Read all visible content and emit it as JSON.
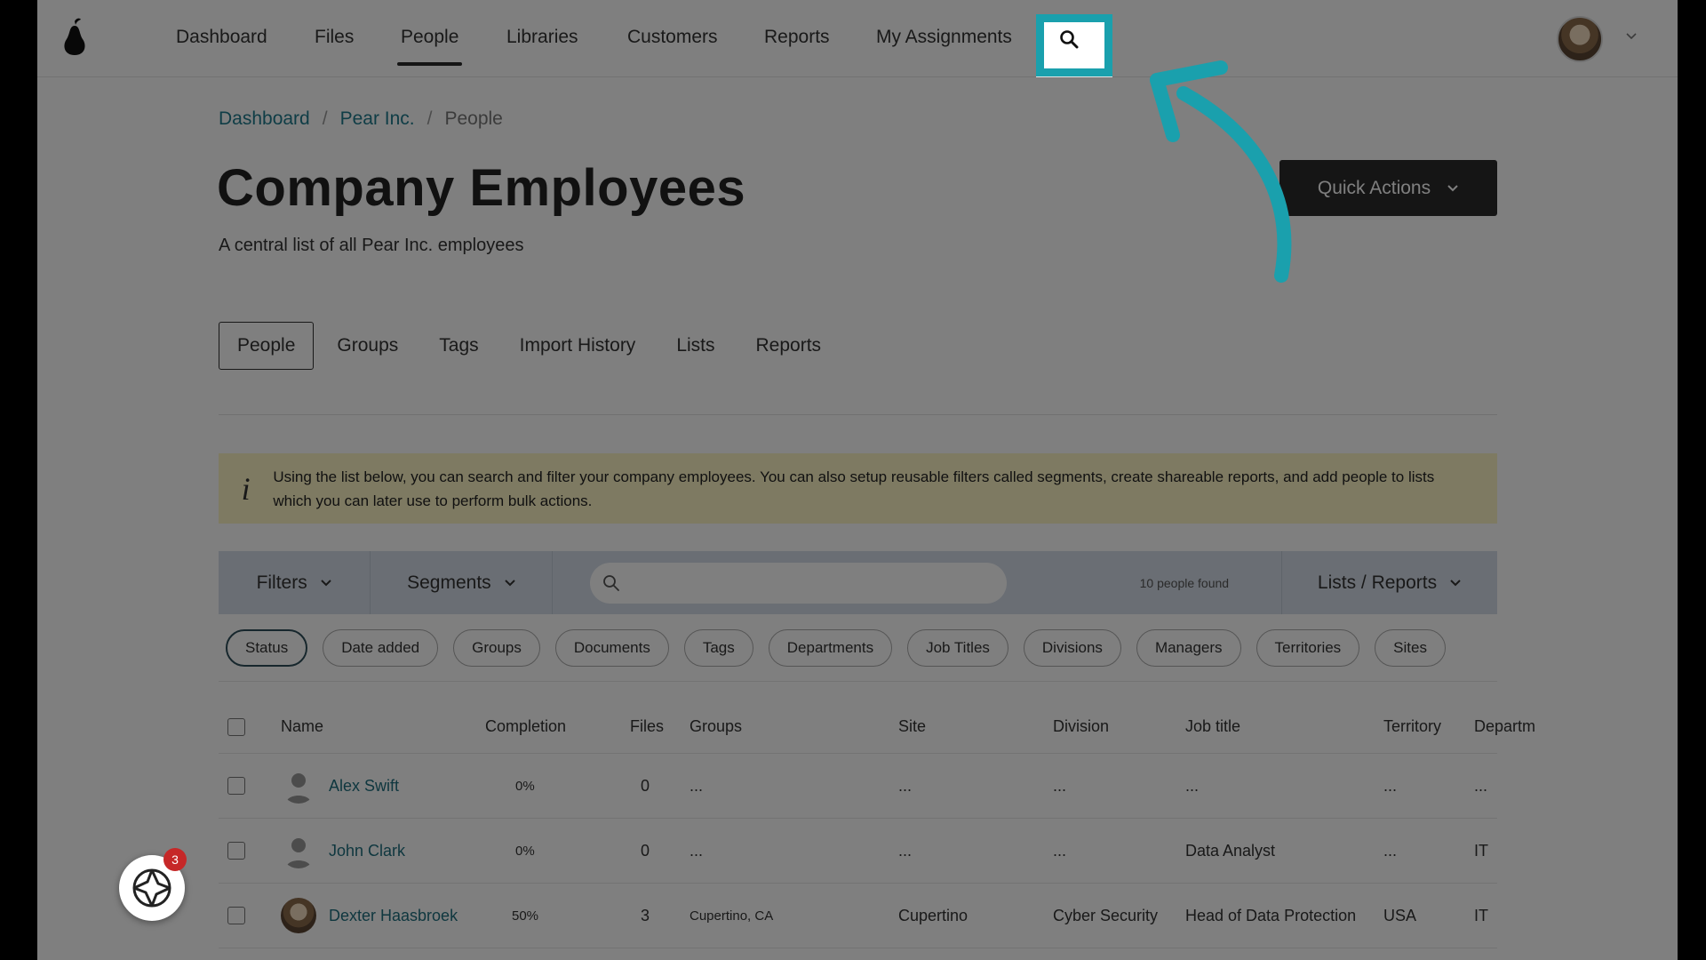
{
  "nav": {
    "items": [
      "Dashboard",
      "Files",
      "People",
      "Libraries",
      "Customers",
      "Reports",
      "My Assignments"
    ],
    "active": "People"
  },
  "breadcrumb": {
    "items": [
      "Dashboard",
      "Pear Inc.",
      "People"
    ],
    "separator": "/"
  },
  "page": {
    "title": "Company Employees",
    "subtitle": "A central list of all Pear Inc. employees",
    "quick_actions_label": "Quick Actions"
  },
  "subtabs": {
    "items": [
      "People",
      "Groups",
      "Tags",
      "Import History",
      "Lists",
      "Reports"
    ],
    "active": "People"
  },
  "info_banner": {
    "icon": "i",
    "text": "Using the list below, you can search and filter your company employees. You can also setup reusable filters called segments, create shareable reports, and add people to lists which you can later use to perform bulk actions."
  },
  "toolbar": {
    "filters_label": "Filters",
    "segments_label": "Segments",
    "search_placeholder": "",
    "count_text": "10 people found",
    "lists_reports_label": "Lists / Reports"
  },
  "chips": [
    "Status",
    "Date added",
    "Groups",
    "Documents",
    "Tags",
    "Departments",
    "Job Titles",
    "Divisions",
    "Managers",
    "Territories",
    "Sites"
  ],
  "table": {
    "headers": {
      "name": "Name",
      "completion": "Completion",
      "files": "Files",
      "groups": "Groups",
      "site": "Site",
      "division": "Division",
      "job_title": "Job title",
      "territory": "Territory",
      "department": "Departm"
    },
    "rows": [
      {
        "name": "Alex Swift",
        "completion": "0%",
        "files": "0",
        "groups": "...",
        "site": "...",
        "division": "...",
        "job_title": "...",
        "territory": "...",
        "department": "..."
      },
      {
        "name": "John Clark",
        "completion": "0%",
        "files": "0",
        "groups": "...",
        "site": "...",
        "division": "...",
        "job_title": "Data Analyst",
        "territory": "...",
        "department": "IT"
      },
      {
        "name": "Dexter Haasbroek",
        "completion": "50%",
        "files": "3",
        "groups": "Cupertino, CA",
        "site": "Cupertino",
        "division": "Cyber Security",
        "job_title": "Head of Data Protection",
        "territory": "USA",
        "department": "IT"
      }
    ]
  },
  "widget": {
    "badge": "3"
  },
  "colors": {
    "highlight": "#1aa0ad",
    "link": "#1f6f7f",
    "banner": "#fdf4c4",
    "toolbar": "#d5dde8",
    "dark_button": "#2b2b2b"
  }
}
